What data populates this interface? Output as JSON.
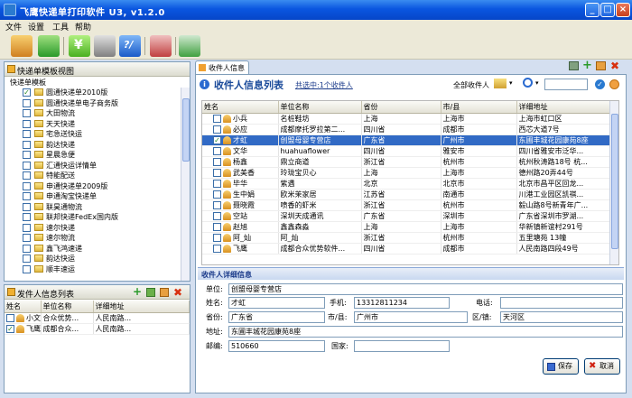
{
  "window": {
    "title": "飞鹰快递单打印软件 U3, v1.2.0"
  },
  "menu": [
    "文件",
    "设置",
    "工具",
    "帮助"
  ],
  "template_panel": {
    "title": "快递单模板视图",
    "root": "快递单模板",
    "items": [
      {
        "label": "圆通快递单2010版",
        "checked": true
      },
      {
        "label": "圆通快递单电子商务版",
        "checked": false
      },
      {
        "label": "大田物流",
        "checked": false
      },
      {
        "label": "天天快递",
        "checked": false
      },
      {
        "label": "宅急送快运",
        "checked": false
      },
      {
        "label": "韵达快递",
        "checked": false
      },
      {
        "label": "星晨急便",
        "checked": false
      },
      {
        "label": "汇通快运详情单",
        "checked": false
      },
      {
        "label": "特能配送",
        "checked": false
      },
      {
        "label": "申通快递单2009版",
        "checked": false
      },
      {
        "label": "申通淘宝快递单",
        "checked": false
      },
      {
        "label": "联昊通物流",
        "checked": false
      },
      {
        "label": "联邦快递FedEx国内版",
        "checked": false
      },
      {
        "label": "速尔快递",
        "checked": false
      },
      {
        "label": "速尔物流",
        "checked": false
      },
      {
        "label": "鑫飞鸿速递",
        "checked": false
      },
      {
        "label": "韵达快运",
        "checked": false
      },
      {
        "label": "顺丰速运",
        "checked": false
      }
    ]
  },
  "sender_panel": {
    "title": "发件人信息列表",
    "columns": [
      "姓名",
      "单位名称",
      "详细地址"
    ],
    "rows": [
      {
        "name": "小文",
        "company": "合众优势...",
        "address": "人民南路...",
        "checked": false
      },
      {
        "name": "飞鹰",
        "company": "成都合众...",
        "address": "人民南路...",
        "checked": true
      }
    ]
  },
  "recipient": {
    "tab": "收件人信息",
    "heading": "收件人信息列表",
    "selection_info": "共选中:1个收件人",
    "all_label": "全部收件人",
    "columns": [
      "姓名",
      "单位名称",
      "省份",
      "市/县",
      "详细地址"
    ],
    "rows": [
      {
        "name": "小兵",
        "company": "名桩鞋坊",
        "province": "上海",
        "city": "上海市",
        "address": "上海市虹口区",
        "checked": false
      },
      {
        "name": "必应",
        "company": "成都摩托罗拉第二...",
        "province": "四川省",
        "city": "成都市",
        "address": "西芯大道7号",
        "checked": false
      },
      {
        "name": "才虹",
        "company": "创盟母婴专营店",
        "province": "广东省",
        "city": "广州市",
        "address": "东圃丰城花园康苑8座",
        "checked": true
      },
      {
        "name": "文华",
        "company": "huahuaflower",
        "province": "四川省",
        "city": "雅安市",
        "address": "四川省雅安市泛华...",
        "checked": false
      },
      {
        "name": "杨鑫",
        "company": "鼎立商道",
        "province": "浙江省",
        "city": "杭州市",
        "address": "杭州秋涛路18号 杭...",
        "checked": false
      },
      {
        "name": "武美香",
        "company": "玲珑宝贝心",
        "province": "上海",
        "city": "上海市",
        "address": "德州路20弄44号",
        "checked": false
      },
      {
        "name": "毕华",
        "company": "紫遇",
        "province": "北京",
        "city": "北京市",
        "address": "北京市昌平区回龙...",
        "checked": false
      },
      {
        "name": "生中娟",
        "company": "欧米茉家居",
        "province": "江苏省",
        "city": "南通市",
        "address": "川港工业园区凯祺...",
        "checked": false
      },
      {
        "name": "聂晓霞",
        "company": "喷香的虾米",
        "province": "浙江省",
        "city": "杭州市",
        "address": "毅山路8号新青年广...",
        "checked": false
      },
      {
        "name": "空站",
        "company": "深圳天成通讯",
        "province": "广东省",
        "city": "深圳市",
        "address": "广东省深圳市罗湖...",
        "checked": false
      },
      {
        "name": "赵旭",
        "company": "鑫鑫森淼",
        "province": "上海",
        "city": "上海市",
        "address": "华新镇新谊村291号",
        "checked": false
      },
      {
        "name": "阿_灿",
        "company": "阿_灿",
        "province": "浙江省",
        "city": "杭州市",
        "address": "五里塘苑 13幢",
        "checked": false
      },
      {
        "name": "飞鹰",
        "company": "成都合众优势软件...",
        "province": "四川省",
        "city": "成都市",
        "address": "人民南路四段49号",
        "checked": false
      }
    ]
  },
  "detail": {
    "title": "收件人详细信息",
    "labels": {
      "company": "单位:",
      "name": "姓名:",
      "mobile": "手机:",
      "phone": "电话:",
      "province": "省份:",
      "city": "市/县:",
      "district": "区/镇:",
      "address": "地址:",
      "zip": "邮编:",
      "country": "国家:"
    },
    "values": {
      "company": "创盟母婴专营店",
      "name": "才虹",
      "mobile": "13312811234",
      "phone": "",
      "province": "广东省",
      "city": "广州市",
      "district": "天河区",
      "address": "东圃丰城花园康苑8座",
      "zip": "510660",
      "country": ""
    },
    "save": "保存",
    "cancel": "取消"
  }
}
